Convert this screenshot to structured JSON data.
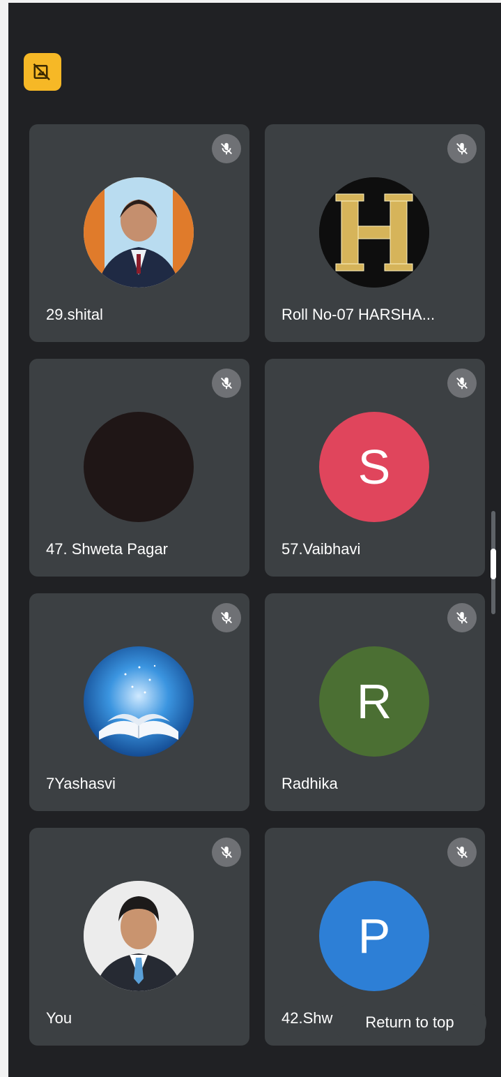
{
  "tiles": [
    {
      "name": "29.shital",
      "avatar": "photo-woman",
      "letter": ""
    },
    {
      "name": "Roll No-07 HARSHA...",
      "avatar": "gold-letter-h",
      "letter": ""
    },
    {
      "name": "47. Shweta Pagar",
      "avatar": "dark-circle",
      "letter": ""
    },
    {
      "name": "57.Vaibhavi",
      "avatar": "letter",
      "letter": "S",
      "color": "#e0455c"
    },
    {
      "name": "7Yashasvi",
      "avatar": "book-image",
      "letter": ""
    },
    {
      "name": "Radhika",
      "avatar": "letter",
      "letter": "R",
      "color": "#4b6f33"
    },
    {
      "name": "You",
      "avatar": "photo-man",
      "letter": ""
    },
    {
      "name": "42.Shw",
      "avatar": "letter",
      "letter": "P",
      "color": "#2d7fd6"
    }
  ],
  "icons": {
    "top_badge": "camera-off-icon",
    "tile_status": "mic-off-icon"
  },
  "colors": {
    "background": "#202124",
    "tile": "#3c4043",
    "badge": "#f6b826"
  },
  "return_to_top": "Return to top"
}
